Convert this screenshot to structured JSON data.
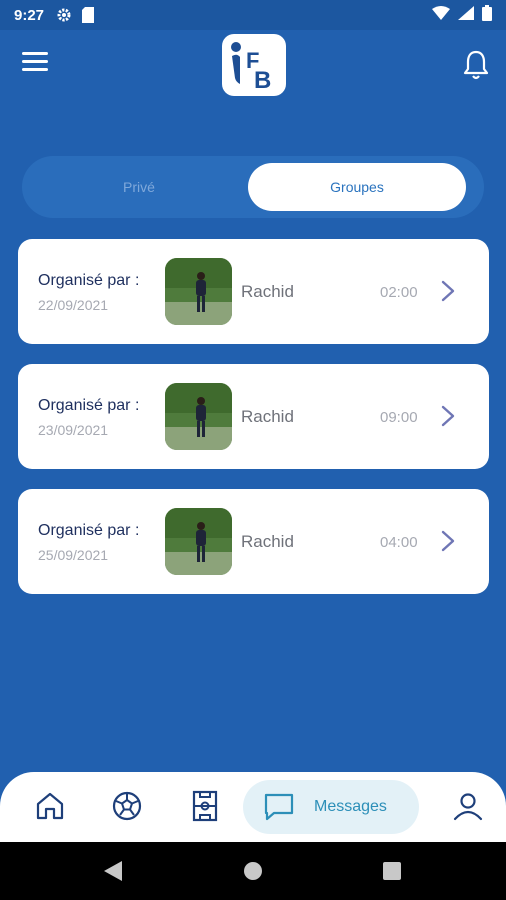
{
  "status_bar": {
    "time": "9:27"
  },
  "header": {
    "logo_text": "FB"
  },
  "tabs": {
    "prive": "Privé",
    "groupes": "Groupes",
    "active": "groupes"
  },
  "events": [
    {
      "organizer_label": "Organisé par :",
      "date": "22/09/2021",
      "name": "Rachid",
      "time": "02:00"
    },
    {
      "organizer_label": "Organisé par :",
      "date": "23/09/2021",
      "name": "Rachid",
      "time": "09:00"
    },
    {
      "organizer_label": "Organisé par :",
      "date": "25/09/2021",
      "name": "Rachid",
      "time": "04:00"
    }
  ],
  "bottom_nav": {
    "active_label": "Messages"
  },
  "icons": {
    "menu": "menu-icon",
    "bell": "bell-icon",
    "home": "home-icon",
    "ball": "soccer-ball-icon",
    "field": "field-icon",
    "chat": "chat-icon",
    "profile": "profile-icon",
    "chevron": "chevron-right-icon"
  },
  "colors": {
    "background": "#2160AF",
    "accent": "#2C8FB8",
    "title_text": "#1E2F5E",
    "card": "#FFFFFF"
  }
}
